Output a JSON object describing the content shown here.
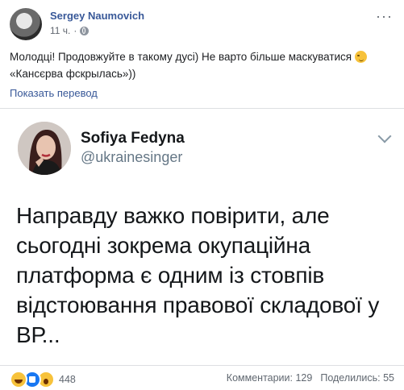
{
  "post": {
    "author": "Sergey Naumovich",
    "time": "11 ч.",
    "separator": "·",
    "text_main": "Молодці! Продовжуйте в такому дусі) Не варто більше маскуватися ",
    "text_end": "«Кансєрва фскрылась»))",
    "emoji": "smirk-emoji",
    "see_translation": "Показать перевод",
    "more": "···"
  },
  "tweet": {
    "name": "Sofiya Fedyna",
    "handle": "@ukrainesinger",
    "text": "Направду важко повірити, але сьогодні зокрема окупаційна платформа є одним із стовпів відстоювання правової складової у ВР..."
  },
  "footer": {
    "reaction_count": "448",
    "comments": "Комментарии: 129",
    "shares": "Поделились: 55"
  }
}
